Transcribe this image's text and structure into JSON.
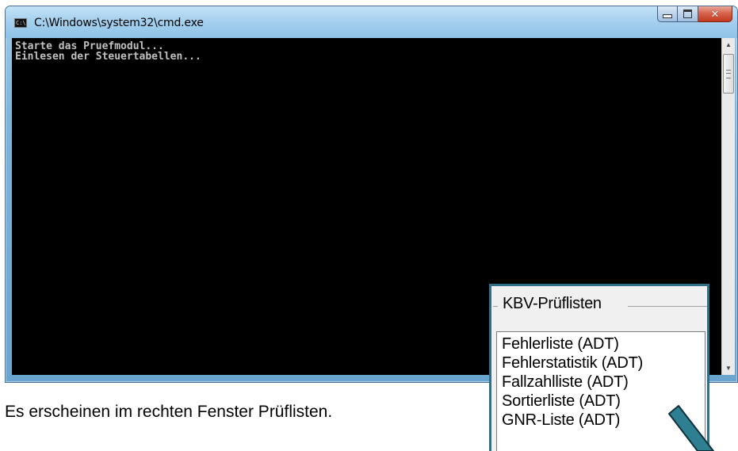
{
  "window": {
    "title": "C:\\Windows\\system32\\cmd.exe",
    "icon": "cmd-icon",
    "icon_text": "C:\\"
  },
  "console": {
    "lines": [
      "Starte das Pruefmodul...",
      "Einlesen der Steuertabellen..."
    ]
  },
  "caption": "Es erscheinen im rechten Fenster Prüflisten.",
  "kbv_panel": {
    "legend": "KBV-Prüflisten",
    "items": [
      "Fehlerliste (ADT)",
      "Fehlerstatistik (ADT)",
      "Fallzahlliste (ADT)",
      "Sortierliste (ADT)",
      "GNR-Liste (ADT)"
    ]
  },
  "colors": {
    "console_bg": "#000000",
    "console_text": "#c0c0c0",
    "highlight_border": "#2f6f8a",
    "pointer_arrow": "#2f7f92"
  }
}
